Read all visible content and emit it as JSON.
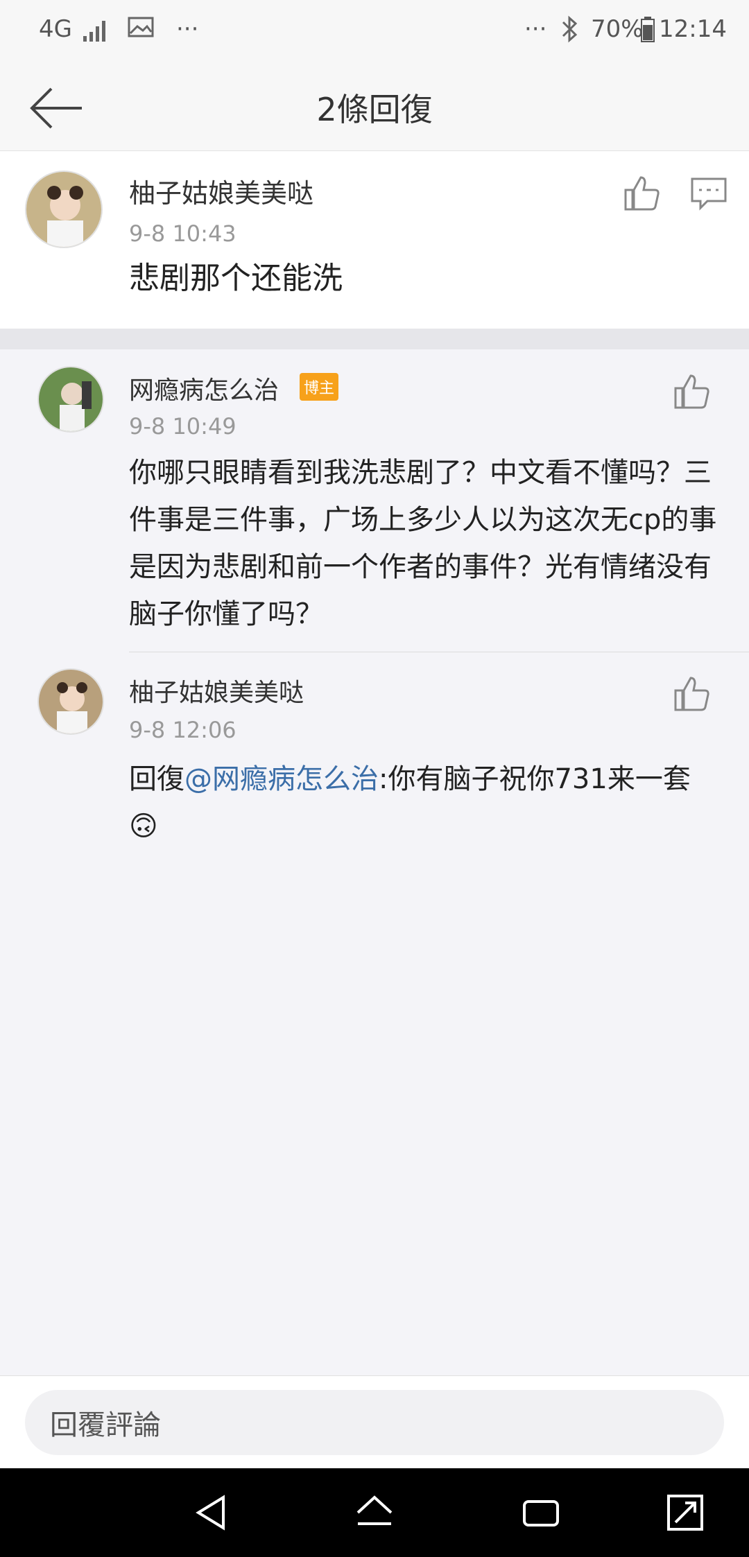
{
  "status_bar": {
    "network": "4G",
    "more": "···",
    "more_right": "···",
    "battery": "70%",
    "time": "12:14"
  },
  "header": {
    "title": "2條回復"
  },
  "main_comment": {
    "name": "柚子姑娘美美哒",
    "time": "9-8 10:43",
    "text": "悲剧那个还能洗"
  },
  "replies": [
    {
      "name": "网瘾病怎么治",
      "badge": "博主",
      "time": "9-8 10:49",
      "text": "你哪只眼睛看到我洗悲剧了？中文看不懂吗？三件事是三件事，广场上多少人以为这次无cp的事是因为悲剧和前一个作者的事件？光有情绪没有脑子你懂了吗？"
    },
    {
      "name": "柚子姑娘美美哒",
      "time": "9-8 12:06",
      "reply_prefix": "回復",
      "mention": "@网瘾病怎么治",
      "text": ":你有脑子祝你731来一套",
      "emoji": "🙃"
    }
  ],
  "bottom": {
    "placeholder": "回覆評論"
  },
  "colors": {
    "accent_link": "#3b6ea8",
    "badge": "#f7a11a"
  }
}
